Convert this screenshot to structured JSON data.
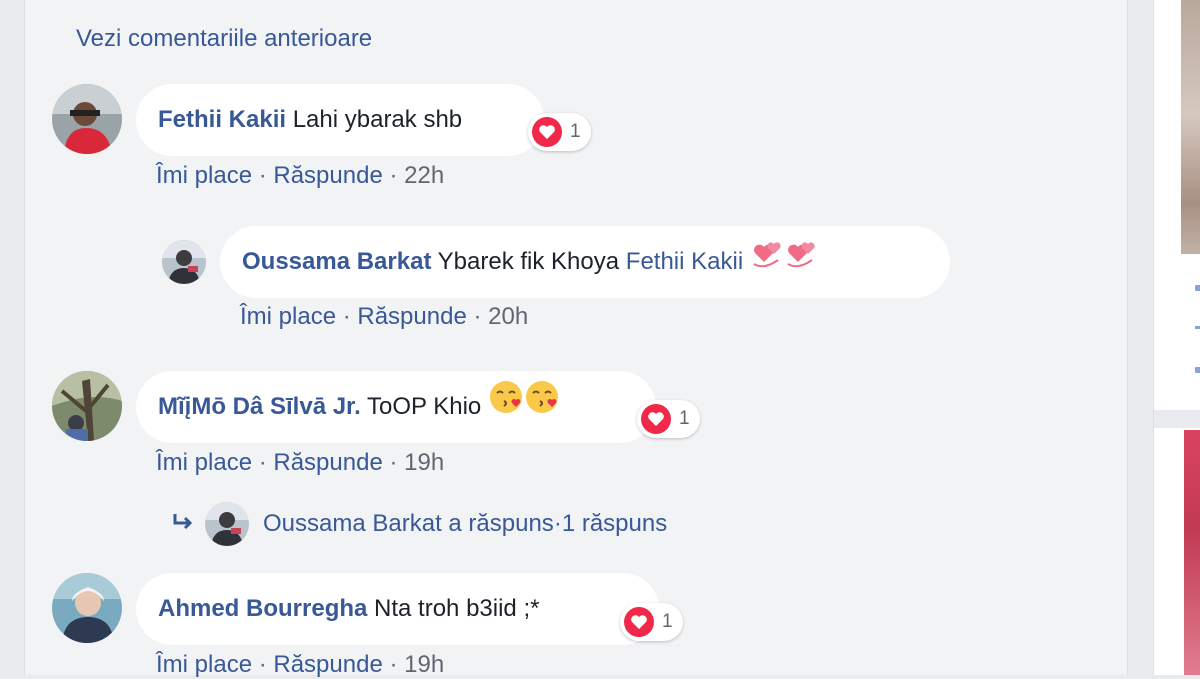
{
  "previous_comments_link": "Vezi comentariile anterioare",
  "separator": " · ",
  "comments": [
    {
      "author": "Fethii Kakii",
      "text": "Lahi ybarak shb",
      "reaction_count": "1",
      "like": "Îmi place",
      "reply": "Răspunde",
      "time": "22h"
    },
    {
      "author": "Oussama Barkat",
      "text": "Ybarek fik Khoya",
      "mention": "Fethii Kakii",
      "emoji": [
        "revolving-hearts-icon",
        "revolving-hearts-icon"
      ],
      "like": "Îmi place",
      "reply": "Răspunde",
      "time": "20h"
    },
    {
      "author": "MĩįMō Dâ Sīlvā Jr.",
      "text": "ToOP Khio",
      "emoji": [
        "kissing-face-icon",
        "kissing-face-icon"
      ],
      "reaction_count": "1",
      "like": "Îmi place",
      "reply": "Răspunde",
      "time": "19h"
    },
    {
      "author": "Ahmed Bourregha",
      "text": "Nta troh b3iid ;*",
      "reaction_count": "1",
      "like": "Îmi place",
      "reply": "Răspunde",
      "time": "19h"
    }
  ],
  "reply_summary": {
    "text": "Oussama Barkat a răspuns",
    "count": "1 răspuns"
  },
  "colors": {
    "link": "#385898",
    "meta": "#606770",
    "bubble": "#ffffff",
    "background": "#f2f3f5",
    "love_reaction": "#f0284a"
  }
}
